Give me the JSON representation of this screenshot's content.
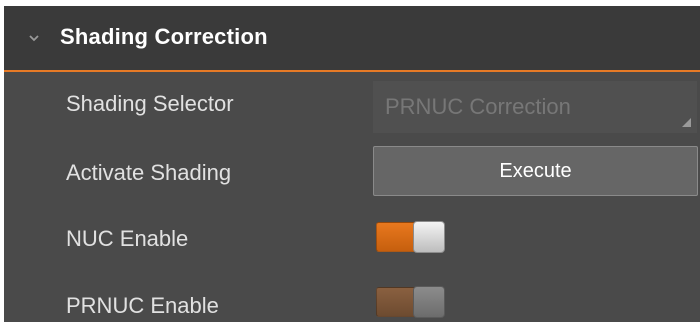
{
  "section": {
    "title": "Shading Correction",
    "expanded": true,
    "chevron_icon": "chevron-down-icon"
  },
  "rows": {
    "shading_selector": {
      "label": "Shading Selector",
      "value": "PRNUC Correction",
      "disabled": true
    },
    "activate_shading": {
      "label": "Activate Shading",
      "button_label": "Execute"
    },
    "nuc_enable": {
      "label": "NUC Enable",
      "checked": true
    },
    "prnuc_enable": {
      "label": "PRNUC Enable",
      "checked": true,
      "disabled": true
    }
  },
  "colors": {
    "accent": "#e77a26",
    "panel_bg": "#4a4a4a",
    "header_bg": "#3a3a3a",
    "label_text": "#e1e1e1"
  }
}
